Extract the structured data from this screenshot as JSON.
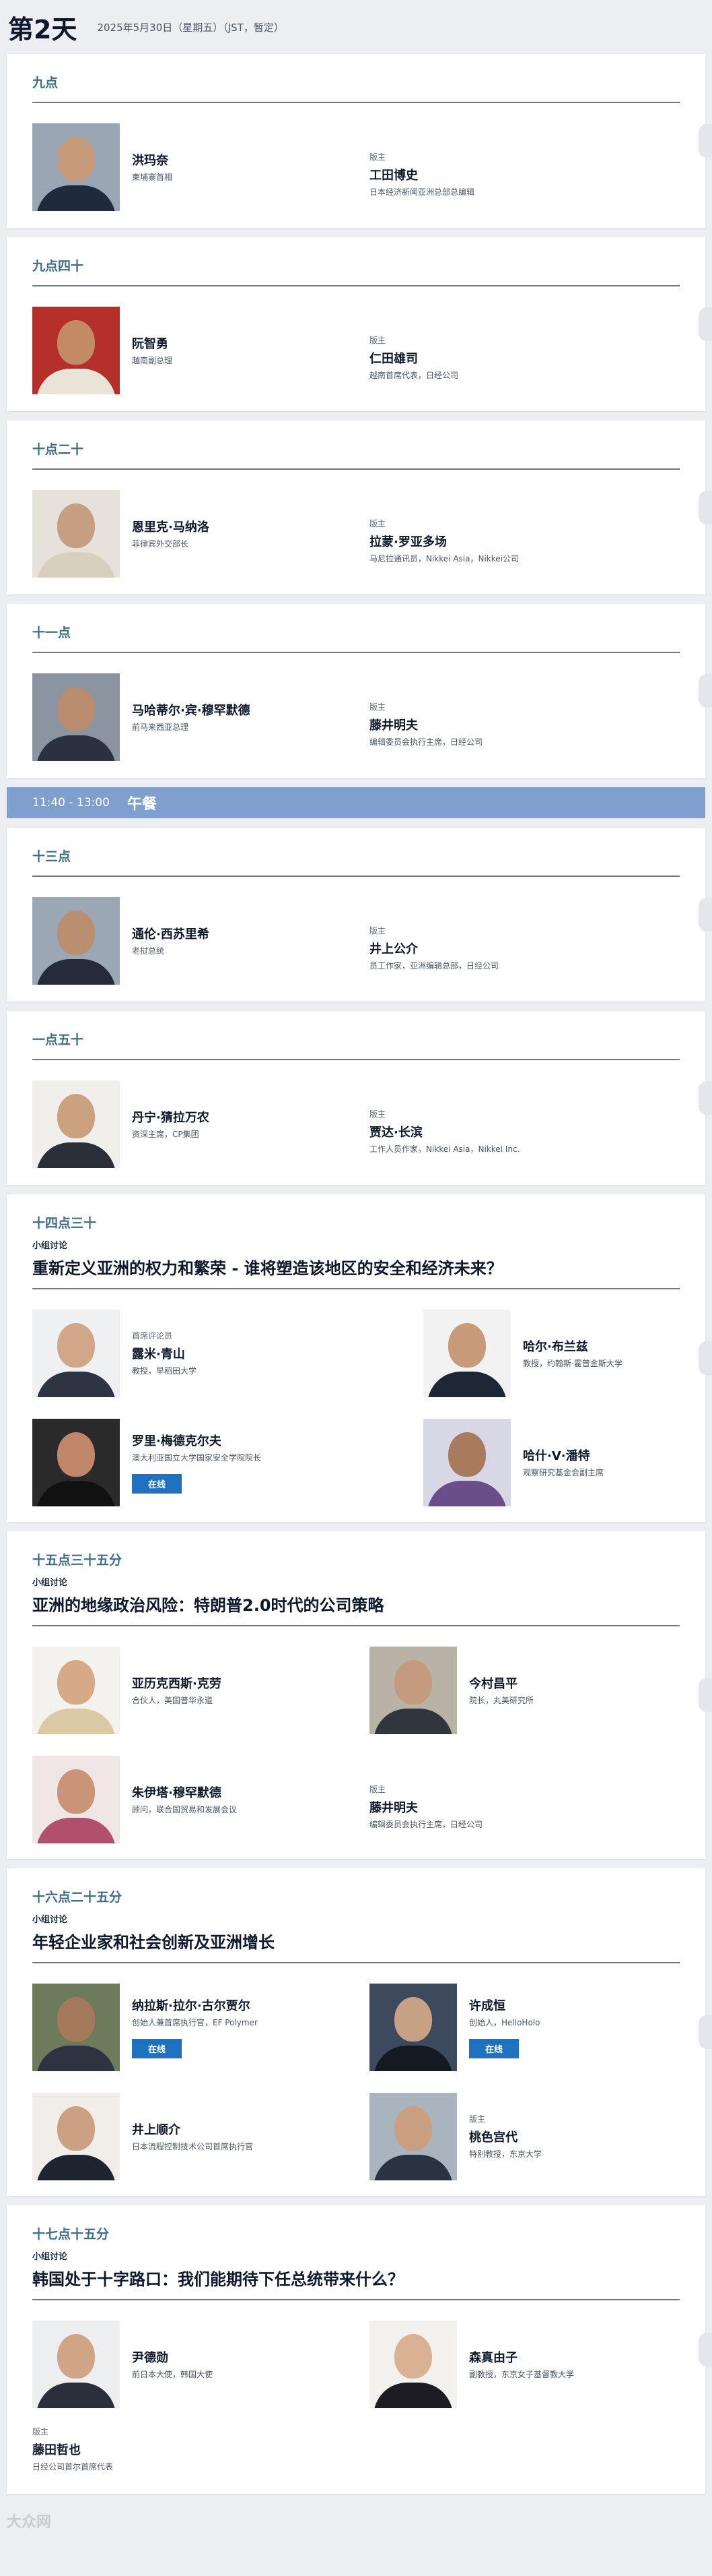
{
  "header": {
    "day": "第2天",
    "date": "2025年5月30日（星期五）（JST，暂定）"
  },
  "sessions": [
    {
      "time": "九点",
      "speaker": {
        "name": "洪玛奈",
        "title": "柬埔寨首相"
      },
      "moderator": {
        "role": "版主",
        "name": "工田博史",
        "title": "日本经济新闻亚洲总部总编辑"
      }
    },
    {
      "time": "九点四十",
      "speaker": {
        "name": "阮智勇",
        "title": "越南副总理"
      },
      "moderator": {
        "role": "版主",
        "name": "仁田雄司",
        "title": "越南首席代表，日经公司"
      }
    },
    {
      "time": "十点二十",
      "speaker": {
        "name": "恩里克·马纳洛",
        "title": "菲律宾外交部长"
      },
      "moderator": {
        "role": "版主",
        "name": "拉蒙·罗亚多场",
        "title": "马尼拉通讯员，Nikkei Asia，Nikkei公司"
      }
    },
    {
      "time": "十一点",
      "speaker": {
        "name": "马哈蒂尔·宾·穆罕默德",
        "title": "前马来西亚总理"
      },
      "moderator": {
        "role": "版主",
        "name": "藤井明夫",
        "title": "编辑委员会执行主席，日经公司"
      }
    }
  ],
  "lunch": {
    "time": "11:40 - 13:00",
    "label": "午餐"
  },
  "sessions2": [
    {
      "time": "十三点",
      "speaker": {
        "name": "通伦·西苏里希",
        "title": "老挝总统"
      },
      "moderator": {
        "role": "版主",
        "name": "井上公介",
        "title": "员工作家，亚洲编辑总部，日经公司"
      }
    },
    {
      "time": "一点五十",
      "speaker": {
        "name": "丹宁·猜拉万农",
        "title": "资深主席，CP集团"
      },
      "moderator": {
        "role": "版主",
        "name": "贾达·长滨",
        "title": "工作人员作家，Nikkei Asia，Nikkei Inc."
      }
    }
  ],
  "panel1": {
    "time": "十四点三十",
    "type": "小组讨论",
    "title": "重新定义亚洲的权力和繁荣 - 谁将塑造该地区的安全和经济未来？",
    "people": [
      {
        "role": "首席评论员",
        "name": "露米·青山",
        "title": "教授，早稻田大学",
        "badge": ""
      },
      {
        "role": "",
        "name": "哈尔·布兰兹",
        "title": "教授，约翰斯·霍普金斯大学",
        "badge": ""
      },
      {
        "role": "",
        "name": "罗里·梅德克尔夫",
        "title": "澳大利亚国立大学国家安全学院院长",
        "badge": "在线"
      },
      {
        "role": "",
        "name": "哈什·V·潘特",
        "title": "观察研究基金会副主席",
        "badge": ""
      }
    ]
  },
  "panel2": {
    "time": "十五点三十五分",
    "type": "小组讨论",
    "title": "亚洲的地缘政治风险：特朗普2.0时代的公司策略",
    "people": [
      {
        "name": "亚历克西斯·克劳",
        "title": "合伙人，美国普华永道"
      },
      {
        "name": "今村昌平",
        "title": "院长，丸美研究所"
      },
      {
        "name": "朱伊塔·穆罕默德",
        "title": "顾问，联合国贸易和发展会议"
      }
    ],
    "moderator": {
      "role": "版主",
      "name": "藤井明夫",
      "title": "编辑委员会执行主席，日经公司"
    }
  },
  "panel3": {
    "time": "十六点二十五分",
    "type": "小组讨论",
    "title": "年轻企业家和社会创新及亚洲增长",
    "people": [
      {
        "role": "",
        "name": "纳拉斯·拉尔·古尔贾尔",
        "title": "创始人兼首席执行官，EF Polymer",
        "badge": "在线"
      },
      {
        "role": "",
        "name": "许成恒",
        "title": "创始人，HelloHolo",
        "badge": "在线"
      },
      {
        "role": "",
        "name": "井上顺介",
        "title": "日本流程控制技术公司首席执行官",
        "badge": ""
      },
      {
        "role": "版主",
        "name": "桃色宫代",
        "title": "特别教授，东京大学",
        "badge": ""
      }
    ]
  },
  "panel4": {
    "time": "十七点十五分",
    "type": "小组讨论",
    "title": "韩国处于十字路口：我们能期待下任总统带来什么？",
    "people": [
      {
        "name": "尹德勋",
        "title": "前日本大使，韩国大使"
      },
      {
        "name": "森真由子",
        "title": "副教授，东京女子基督教大学"
      }
    ],
    "moderator": {
      "role": "版主",
      "name": "藤田哲也",
      "title": "日经公司首尔首席代表"
    }
  },
  "footer": {
    "watermark": "大众网"
  },
  "colors": {
    "accent": "#3f6d87",
    "lunch_bar": "#7f9fcf",
    "online_badge": "#1f72bf"
  }
}
